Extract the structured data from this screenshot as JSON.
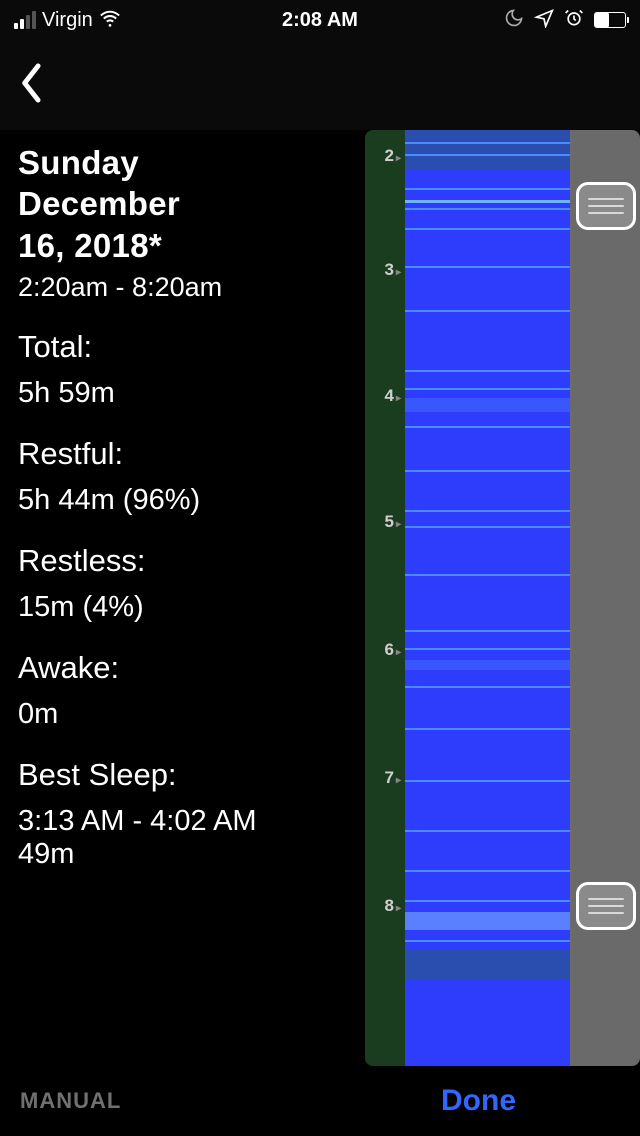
{
  "status": {
    "carrier": "Virgin",
    "time": "2:08 AM"
  },
  "sleep": {
    "date_line1": "Sunday",
    "date_line2": "December",
    "date_line3": "16, 2018*",
    "time_range": "2:20am - 8:20am",
    "total_label": "Total:",
    "total_value": "5h 59m",
    "restful_label": "Restful:",
    "restful_value": "5h 44m (96%)",
    "restless_label": "Restless:",
    "restless_value": "15m (4%)",
    "awake_label": "Awake:",
    "awake_value": "0m",
    "best_label": "Best Sleep:",
    "best_value_line1": "3:13 AM - 4:02 AM",
    "best_value_line2": "49m"
  },
  "timeline": {
    "hours": [
      "2",
      "3",
      "4",
      "5",
      "6",
      "7",
      "8"
    ]
  },
  "footer": {
    "manual": "MANUAL",
    "done": "Done"
  }
}
